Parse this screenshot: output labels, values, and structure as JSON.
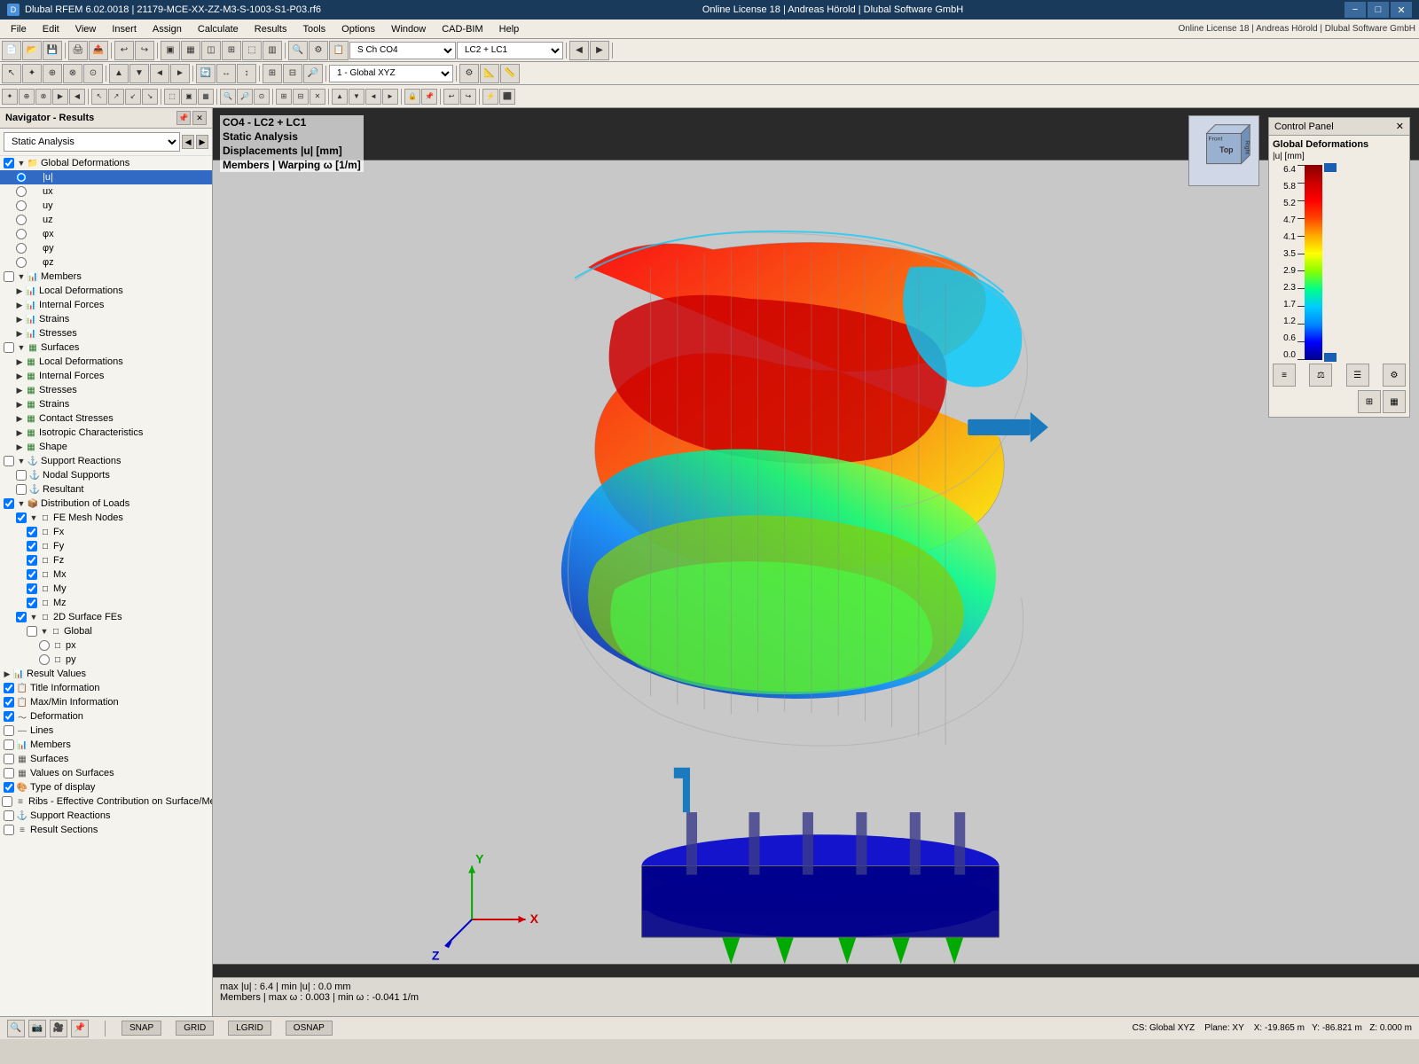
{
  "titleBar": {
    "title": "Dlubal RFEM 6.02.0018 | 21179-MCE-XX-ZZ-M3-S-1003-S1-P03.rf6",
    "licenseInfo": "Online License 18 | Andreas Hörold | Dlubal Software GmbH"
  },
  "menuBar": {
    "items": [
      "File",
      "Edit",
      "View",
      "Insert",
      "Assign",
      "Calculate",
      "Results",
      "Tools",
      "Options",
      "Window",
      "CAD-BIM",
      "Help"
    ]
  },
  "navigator": {
    "title": "Navigator - Results",
    "dropdown": "Static Analysis",
    "tree": [
      {
        "id": "global-deformations",
        "label": "Global Deformations",
        "level": 0,
        "type": "folder",
        "checked": true,
        "expanded": true
      },
      {
        "id": "u-abs",
        "label": "|u|",
        "level": 1,
        "type": "radio",
        "checked": true,
        "selected": true
      },
      {
        "id": "ux",
        "label": "ux",
        "level": 1,
        "type": "radio",
        "checked": false
      },
      {
        "id": "uy",
        "label": "uy",
        "level": 1,
        "type": "radio",
        "checked": false
      },
      {
        "id": "uz",
        "label": "uz",
        "level": 1,
        "type": "radio",
        "checked": false
      },
      {
        "id": "phix",
        "label": "φx",
        "level": 1,
        "type": "radio",
        "checked": false
      },
      {
        "id": "phiy",
        "label": "φy",
        "level": 1,
        "type": "radio",
        "checked": false
      },
      {
        "id": "phiz",
        "label": "φz",
        "level": 1,
        "type": "radio",
        "checked": false
      },
      {
        "id": "members",
        "label": "Members",
        "level": 0,
        "type": "folder",
        "checked": false,
        "expanded": true
      },
      {
        "id": "local-deformations",
        "label": "Local Deformations",
        "level": 1,
        "type": "folder",
        "checked": false
      },
      {
        "id": "internal-forces-members",
        "label": "Internal Forces",
        "level": 1,
        "type": "folder",
        "checked": false
      },
      {
        "id": "strains-members",
        "label": "Strains",
        "level": 1,
        "type": "folder",
        "checked": false
      },
      {
        "id": "stresses-members",
        "label": "Stresses",
        "level": 1,
        "type": "folder",
        "checked": false
      },
      {
        "id": "surfaces",
        "label": "Surfaces",
        "level": 0,
        "type": "folder",
        "checked": false,
        "expanded": true
      },
      {
        "id": "local-deformations-surf",
        "label": "Local Deformations",
        "level": 1,
        "type": "folder",
        "checked": false
      },
      {
        "id": "internal-forces-surf",
        "label": "Internal Forces",
        "level": 1,
        "type": "folder",
        "checked": false
      },
      {
        "id": "stresses-surf",
        "label": "Stresses",
        "level": 1,
        "type": "folder",
        "checked": false
      },
      {
        "id": "strains-surf",
        "label": "Strains",
        "level": 1,
        "type": "folder",
        "checked": false
      },
      {
        "id": "contact-stresses",
        "label": "Contact Stresses",
        "level": 1,
        "type": "folder",
        "checked": false
      },
      {
        "id": "isotropic",
        "label": "Isotropic Characteristics",
        "level": 1,
        "type": "folder",
        "checked": false
      },
      {
        "id": "shape",
        "label": "Shape",
        "level": 1,
        "type": "folder",
        "checked": false
      },
      {
        "id": "support-reactions",
        "label": "Support Reactions",
        "level": 0,
        "type": "folder",
        "checked": false,
        "expanded": true
      },
      {
        "id": "nodal-supports",
        "label": "Nodal Supports",
        "level": 1,
        "type": "folder",
        "checked": false
      },
      {
        "id": "resultant",
        "label": "Resultant",
        "level": 1,
        "type": "folder",
        "checked": false
      },
      {
        "id": "distribution-loads",
        "label": "Distribution of Loads",
        "level": 0,
        "type": "folder",
        "checked": true,
        "expanded": true
      },
      {
        "id": "fe-mesh-nodes",
        "label": "FE Mesh Nodes",
        "level": 1,
        "type": "folder",
        "checked": true,
        "expanded": true
      },
      {
        "id": "fx",
        "label": "Fx",
        "level": 2,
        "type": "checkbox",
        "checked": true
      },
      {
        "id": "fy",
        "label": "Fy",
        "level": 2,
        "type": "checkbox",
        "checked": true
      },
      {
        "id": "fz",
        "label": "Fz",
        "level": 2,
        "type": "checkbox",
        "checked": true
      },
      {
        "id": "mx",
        "label": "Mx",
        "level": 2,
        "type": "checkbox",
        "checked": true
      },
      {
        "id": "my",
        "label": "My",
        "level": 2,
        "type": "checkbox",
        "checked": true
      },
      {
        "id": "mz",
        "label": "Mz",
        "level": 2,
        "type": "checkbox",
        "checked": true
      },
      {
        "id": "2d-surface-fes",
        "label": "2D Surface FEs",
        "level": 1,
        "type": "folder",
        "checked": true,
        "expanded": true
      },
      {
        "id": "global-2d",
        "label": "Global",
        "level": 2,
        "type": "folder",
        "checked": false,
        "expanded": true
      },
      {
        "id": "px",
        "label": "px",
        "level": 3,
        "type": "radio",
        "checked": false
      },
      {
        "id": "py",
        "label": "py",
        "level": 3,
        "type": "radio",
        "checked": false
      },
      {
        "id": "result-values",
        "label": "Result Values",
        "level": 0,
        "type": "folder",
        "checked": false
      },
      {
        "id": "title-information",
        "label": "Title Information",
        "level": 0,
        "type": "folder",
        "checked": true
      },
      {
        "id": "maxmin-information",
        "label": "Max/Min Information",
        "level": 0,
        "type": "folder",
        "checked": true
      },
      {
        "id": "deformation",
        "label": "Deformation",
        "level": 0,
        "type": "folder",
        "checked": true
      },
      {
        "id": "lines",
        "label": "Lines",
        "level": 0,
        "type": "folder",
        "checked": false
      },
      {
        "id": "members-nav",
        "label": "Members",
        "level": 0,
        "type": "folder",
        "checked": false
      },
      {
        "id": "surfaces-nav",
        "label": "Surfaces",
        "level": 0,
        "type": "folder",
        "checked": false
      },
      {
        "id": "values-on-surfaces",
        "label": "Values on Surfaces",
        "level": 0,
        "type": "folder",
        "checked": false
      },
      {
        "id": "type-of-display",
        "label": "Type of display",
        "level": 0,
        "type": "folder",
        "checked": true
      },
      {
        "id": "ribs",
        "label": "Ribs - Effective Contribution on Surface/Me...",
        "level": 0,
        "type": "folder",
        "checked": false
      },
      {
        "id": "support-reactions-nav",
        "label": "Support Reactions",
        "level": 0,
        "type": "folder",
        "checked": false
      },
      {
        "id": "result-sections",
        "label": "Result Sections",
        "level": 0,
        "type": "folder",
        "checked": false
      }
    ]
  },
  "viewport": {
    "headerLine1": "CO4 - LC2 + LC1",
    "headerLine2": "Static Analysis",
    "headerLine3": "Displacements |u| [mm]",
    "headerLine4": "Members | Warping ω [1/m]"
  },
  "controlPanel": {
    "title": "Control Panel",
    "category": "Global Deformations",
    "unit": "|u| [mm]",
    "scaleValues": [
      "6.4",
      "5.8",
      "5.2",
      "4.7",
      "4.1",
      "3.5",
      "2.9",
      "2.3",
      "1.7",
      "1.2",
      "0.6",
      "0.0"
    ]
  },
  "statusBar": {
    "maxInfo": "max |u| : 6.4 | min |u| : 0.0 mm",
    "membersInfo": "Members | max ω : 0.003 | min ω : -0.041 1/m",
    "snapLabel": "SNAP",
    "gridLabel": "GRID",
    "lgridLabel": "LGRID",
    "osnapLabel": "OSNAP",
    "csLabel": "CS: Global XYZ",
    "planeLabel": "Plane: XY",
    "xCoord": "X: -19.865 m",
    "yCoord": "Y: -86.821 m",
    "zCoord": "Z: 0.000 m"
  },
  "toolbar": {
    "comboLoadCase": "LC2 + LC1",
    "comboSystem": "S Ch CO4",
    "comboView": "1 - Global XYZ"
  }
}
